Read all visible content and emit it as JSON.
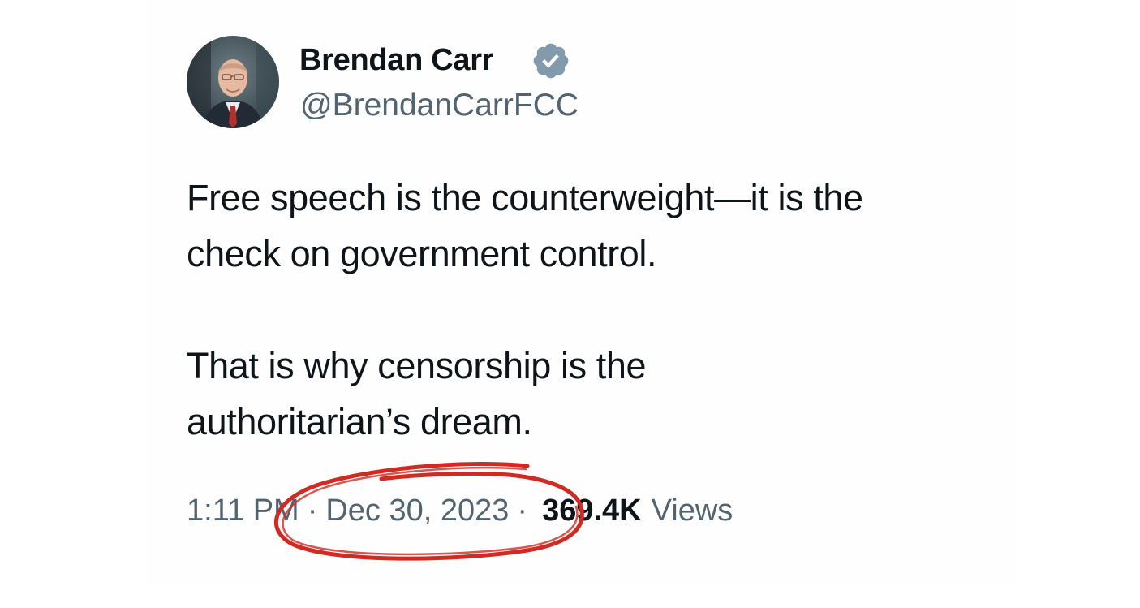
{
  "author": {
    "display_name": "Brendan Carr",
    "handle": "@BrendanCarrFCC",
    "verified_icon": "verified-badge-icon",
    "badge_color": "#829aab"
  },
  "tweet": {
    "paragraphs": [
      "Free speech is the counterweight—it is the\ncheck on government control.",
      "That is why censorship is the\nauthoritarian’s dream."
    ]
  },
  "meta": {
    "time": "1:11 PM",
    "separator": "·",
    "date": "Dec 30, 2023",
    "views_count": "369.4K",
    "views_label": "Views"
  },
  "annotation": {
    "color": "#d12a22",
    "shape": "hand-drawn ellipse around date"
  }
}
